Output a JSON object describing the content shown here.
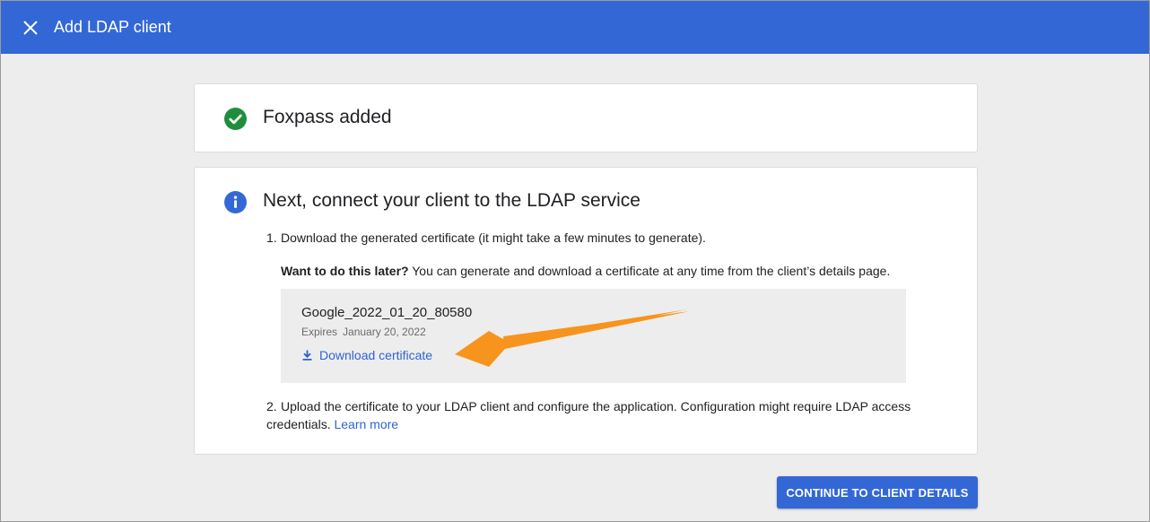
{
  "window": {
    "title": "Add LDAP client"
  },
  "success_card": {
    "title": "Foxpass added"
  },
  "next_card": {
    "title": "Next, connect your client to the LDAP service",
    "step1": {
      "number": "1.",
      "text": "Download the generated certificate (it might take a few minutes to generate)."
    },
    "later_note": {
      "bold": "Want to do this later?",
      "text": " You can generate and download a certificate at any time from the client’s details page."
    },
    "certificate": {
      "name": "Google_2022_01_20_80580",
      "expires_label": "Expires",
      "expires_date": "January 20, 2022",
      "download_label": "Download certificate"
    },
    "step2": {
      "number": "2.",
      "text": "Upload the certificate to your LDAP client and configure the application. Configuration might require LDAP access credentials. ",
      "link": "Learn more"
    }
  },
  "footer": {
    "continue_label": "CONTINUE TO CLIENT DETAILS"
  },
  "colors": {
    "header": "#3467d6",
    "success": "#1e8e3e",
    "info": "#3467d6",
    "link": "#2f63cf",
    "arrow": "#f7941d"
  },
  "icons": {
    "close": "close-icon",
    "success": "check-circle-icon",
    "info": "info-icon",
    "download": "download-icon"
  }
}
